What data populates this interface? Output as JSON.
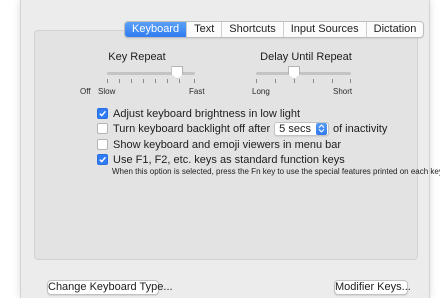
{
  "tabs": [
    {
      "label": "Keyboard",
      "active": true
    },
    {
      "label": "Text",
      "active": false
    },
    {
      "label": "Shortcuts",
      "active": false
    },
    {
      "label": "Input Sources",
      "active": false
    },
    {
      "label": "Dictation",
      "active": false
    }
  ],
  "key_repeat": {
    "title": "Key Repeat",
    "min_label_a": "Off",
    "min_label_b": "Slow",
    "max_label": "Fast",
    "value_fraction": 0.8
  },
  "delay_until_repeat": {
    "title": "Delay Until Repeat",
    "min_label": "Long",
    "max_label": "Short",
    "value_fraction": 0.4
  },
  "options": {
    "adjust_brightness": {
      "label": "Adjust keyboard brightness in low light",
      "checked": true
    },
    "backlight_off": {
      "label_before": "Turn keyboard backlight off after",
      "popup_value": "5 secs",
      "label_after": "of inactivity",
      "checked": false
    },
    "show_viewers": {
      "label": "Show keyboard and emoji viewers in menu bar",
      "checked": false
    },
    "function_keys": {
      "label": "Use F1, F2, etc. keys as standard function keys",
      "checked": true,
      "note": "When this option is selected, press the Fn key to use the special features printed on each key."
    }
  },
  "buttons": {
    "change_keyboard_type": "Change Keyboard Type...",
    "modifier_keys": "Modifier Keys..."
  },
  "colors": {
    "accent": "#2f7cf6"
  }
}
